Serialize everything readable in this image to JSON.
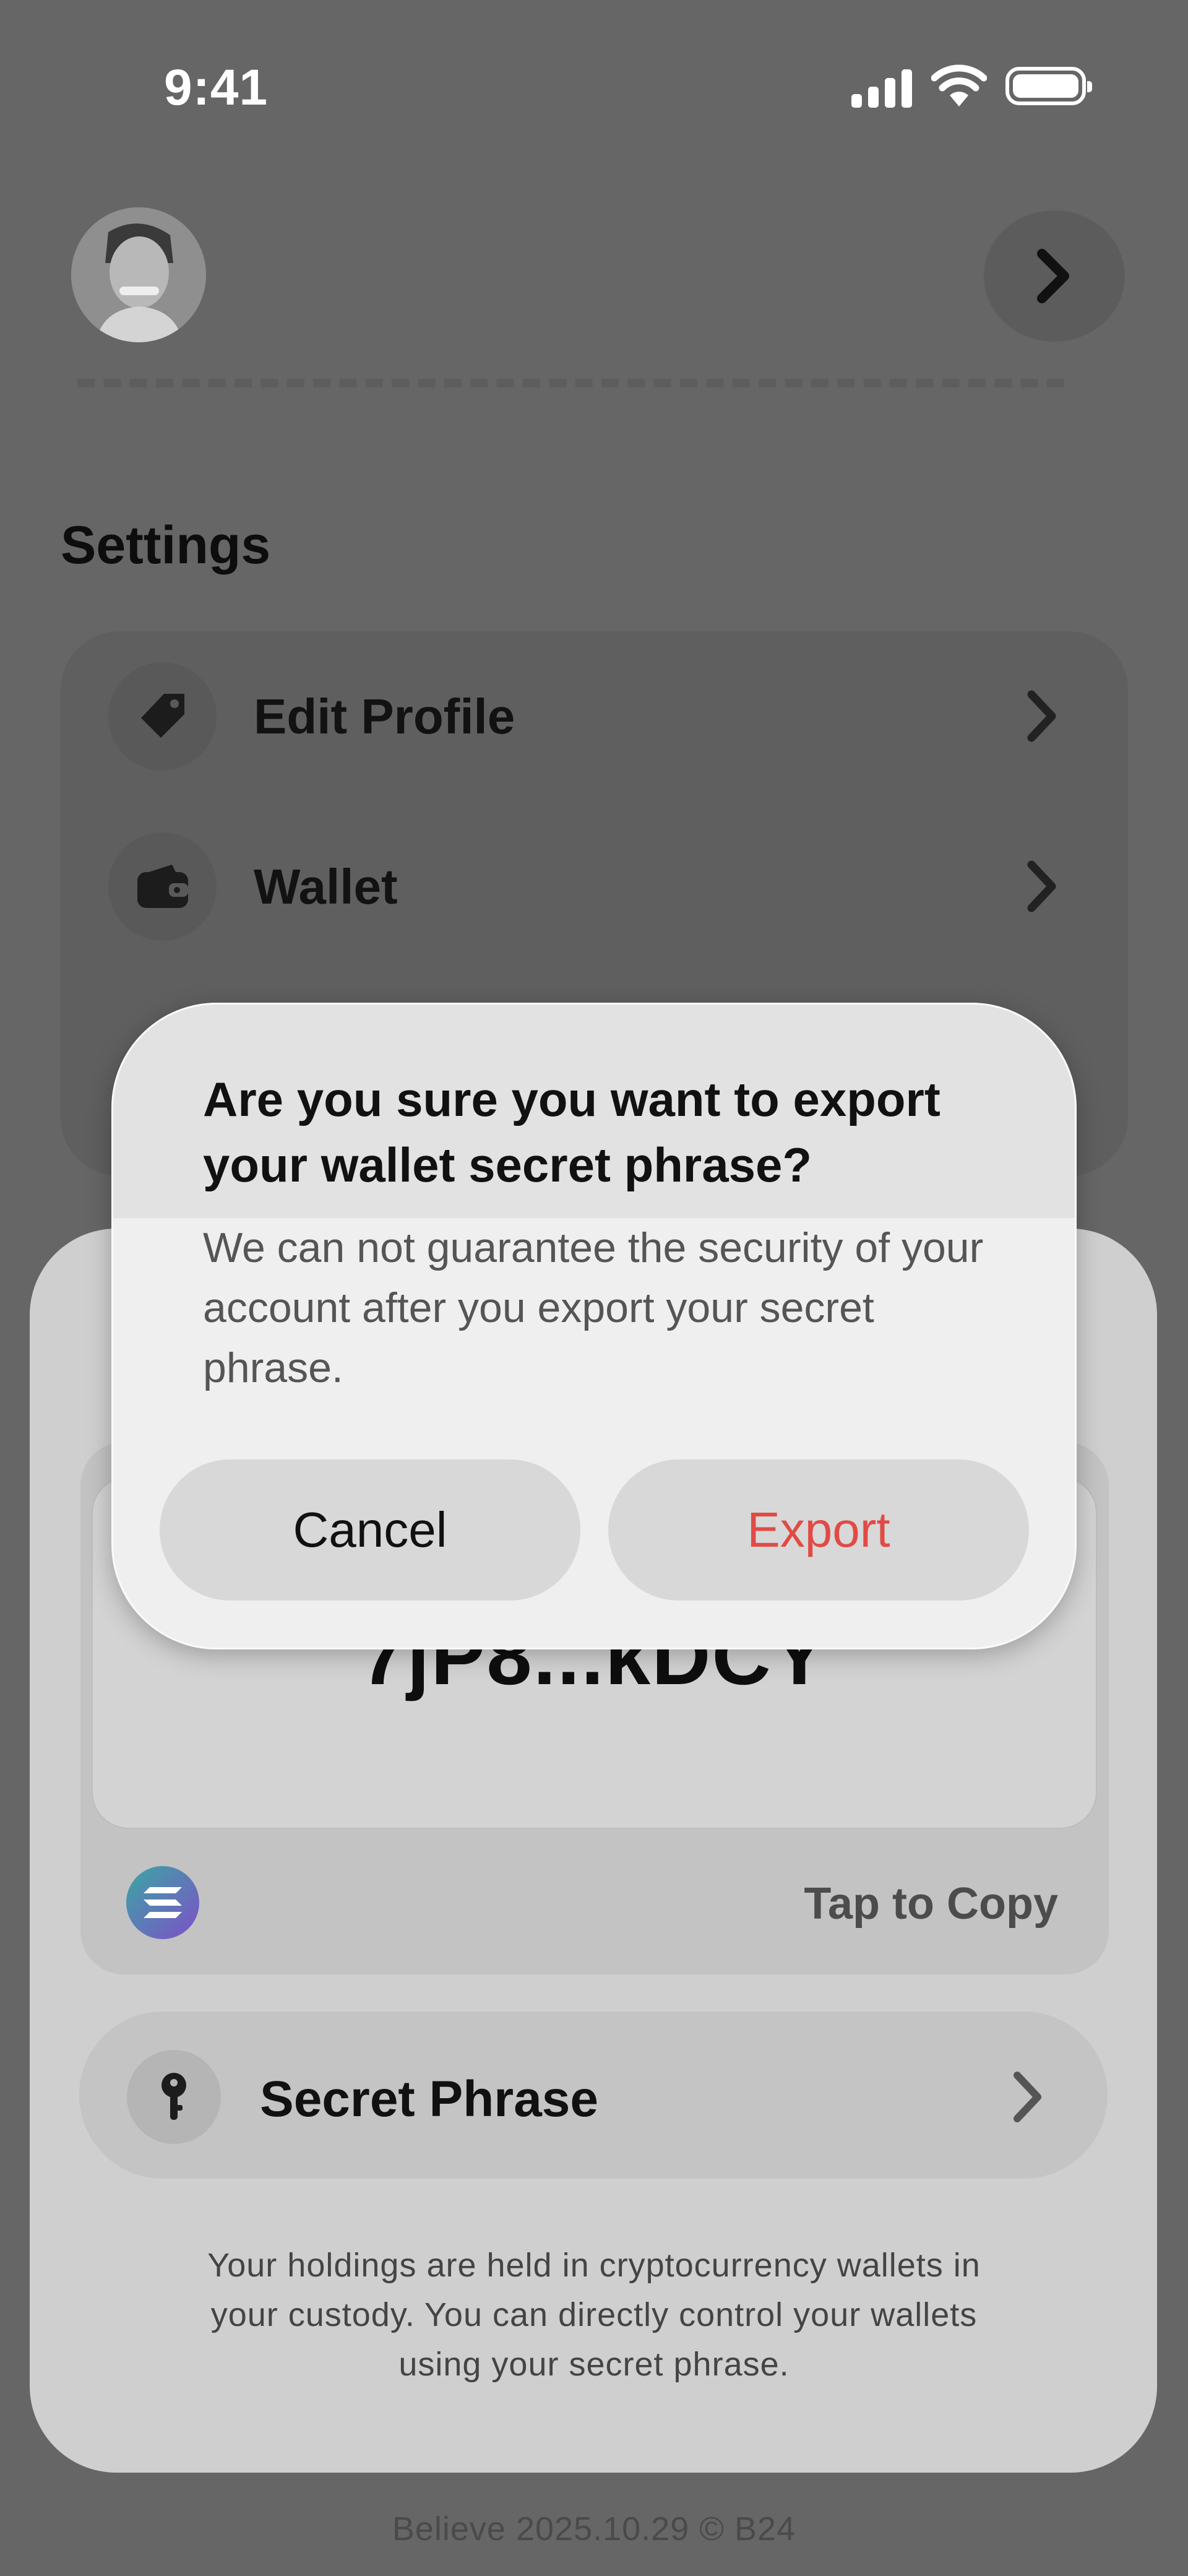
{
  "status_bar": {
    "time": "9:41"
  },
  "settings": {
    "title": "Settings",
    "items": [
      {
        "label": "Edit Profile",
        "icon": "tag-icon"
      },
      {
        "label": "Wallet",
        "icon": "wallet-icon"
      }
    ]
  },
  "wallet_sheet": {
    "address": "7jP8...kDCY",
    "tap_to_copy": "Tap to Copy",
    "network_icon": "solana-logo-icon",
    "secret_phrase_label": "Secret Phrase",
    "disclaimer": "Your holdings are held in cryptocurrency wallets in your custody. You can directly control your wallets using your secret phrase."
  },
  "dialog": {
    "title": "Are you sure you want to export your wallet secret phrase?",
    "message": "We can not guarantee the security of your account after you export your secret phrase.",
    "cancel_label": "Cancel",
    "export_label": "Export"
  },
  "footer": {
    "text": "Believe 2025.10.29 © B24"
  },
  "colors": {
    "destructive": "#e14b45",
    "overlay": "#666666",
    "dialog_bg": "#efefef"
  }
}
